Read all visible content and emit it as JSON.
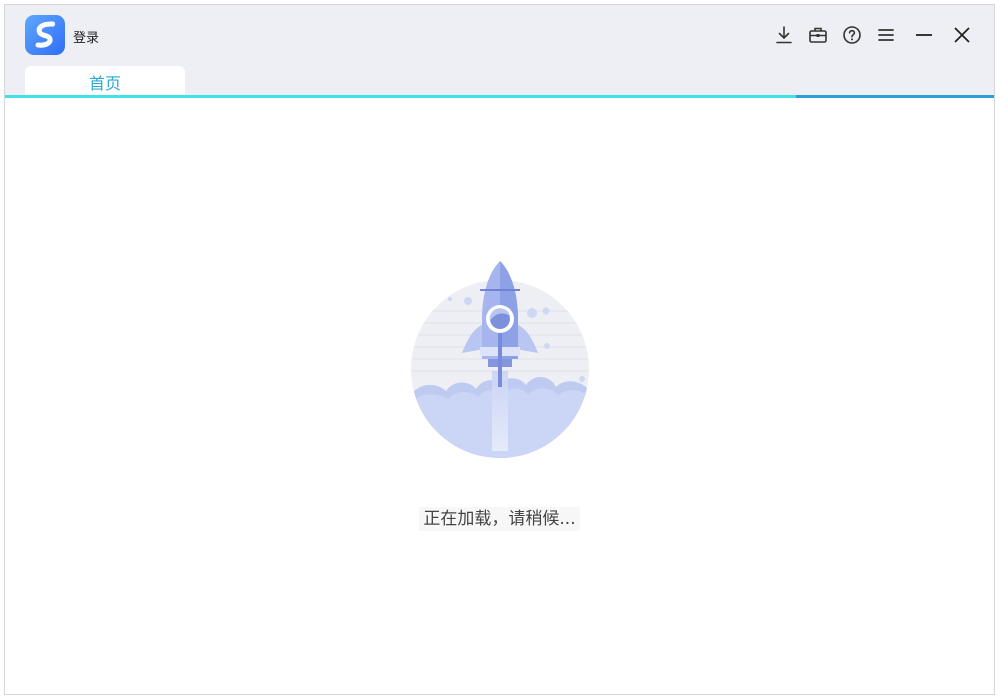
{
  "app": {
    "logo_icon": "app-logo-s-icon",
    "login_label": "登录"
  },
  "toolbar": {
    "icons": [
      "download-icon",
      "toolbox-icon",
      "help-icon",
      "menu-icon",
      "minimize-icon",
      "close-icon"
    ]
  },
  "tabs": [
    {
      "label": "首页",
      "active": true
    }
  ],
  "progress": {
    "fraction": 0.8
  },
  "main": {
    "illustration_icon": "rocket-launch-illustration",
    "loading_text": "正在加载，请稍候..."
  },
  "colors": {
    "accent": "#2aa7d8",
    "progress_fill": "#3fe0e6",
    "illustration": "#8fa4e8"
  }
}
